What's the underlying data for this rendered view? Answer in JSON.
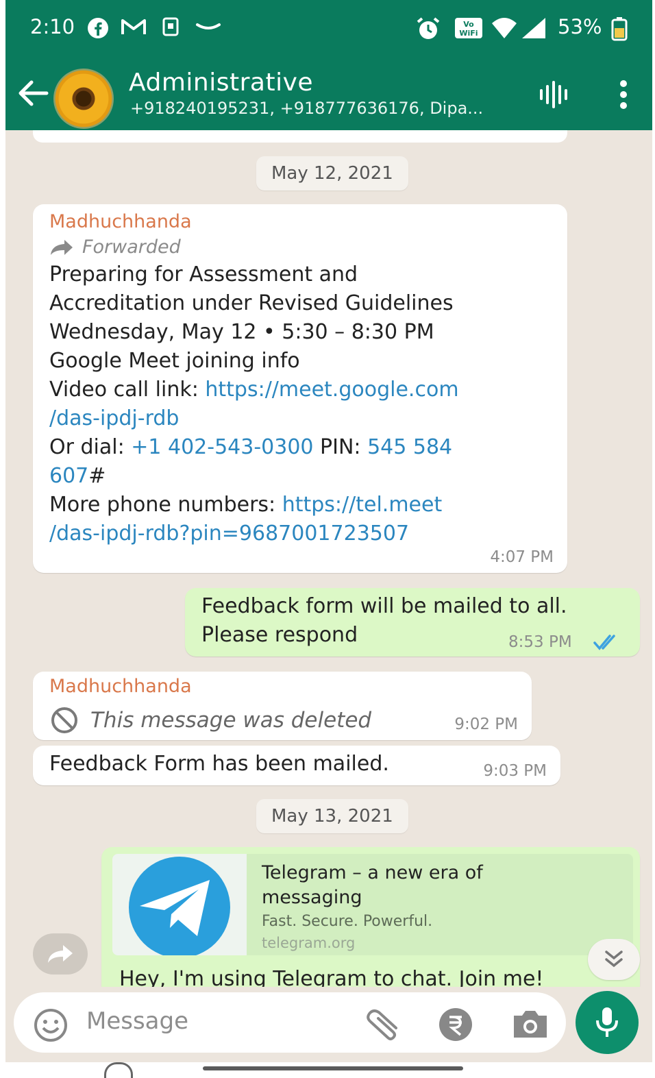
{
  "status_bar": {
    "time": "2:10",
    "battery": "53%"
  },
  "header": {
    "title": "Administrative",
    "subtitle": "+918240195231, +918777636176, Dipa..."
  },
  "chat": {
    "date_1": "May 12, 2021",
    "message_1": {
      "sender": "Madhuchhanda",
      "forwarded": "Forwarded",
      "line1": "Preparing for Assessment and",
      "line2": "Accreditation under Revised Guidelines",
      "line3": "Wednesday, May 12  •  5:30 – 8:30 PM",
      "line4": "Google Meet joining info",
      "line5_text": "Video call link: ",
      "line5_link": "https://meet.google.com",
      "line6_link": "/das-ipdj-rdb",
      "line7_text": "Or dial: ",
      "line7_link": "+1 402-543-0300",
      "line7_mid": " PIN: ",
      "line7_link2": "545 584",
      "line8_link": "607",
      "line8_text": "#",
      "line9_text": "More phone numbers: ",
      "line9_link": "https://tel.meet",
      "line10_link": "/das-ipdj-rdb?pin=9687001723507",
      "time": "4:07 PM"
    },
    "message_2": {
      "line1": "Feedback form will be mailed to all.",
      "line2": "Please respond",
      "time": "8:53 PM"
    },
    "message_3": {
      "sender": "Madhuchhanda",
      "text": "This message was deleted",
      "time": "9:02 PM"
    },
    "message_4": {
      "text": "Feedback Form has been mailed.",
      "time": "9:03 PM"
    },
    "date_2": "May 13, 2021",
    "message_5": {
      "preview_title": "Telegram – a new era of messaging",
      "preview_desc": "Fast. Secure. Powerful.",
      "preview_domain": "telegram.org",
      "text": "Hey, I'm using Telegram to chat. Join me!"
    }
  },
  "composer": {
    "placeholder": "Message"
  },
  "colors": {
    "header": "#0a7b5d",
    "outgoing_bubble": "#dcf8c6",
    "incoming_bubble": "#ffffff",
    "chat_bg": "#ece5dd",
    "link": "#2b86bf",
    "sender": "#d9784b",
    "mic_button": "#0d8f6c"
  },
  "icons": [
    "facebook-icon",
    "gmail-icon",
    "notification-icon",
    "amazon-icon",
    "alarm-icon",
    "vowifi-icon",
    "wifi-icon",
    "signal-icon",
    "battery-icon",
    "back-arrow-icon",
    "voice-chat-icon",
    "more-vert-icon",
    "forward-icon",
    "deleted-icon",
    "double-check-icon",
    "telegram-logo-icon",
    "share-forward-icon",
    "scroll-down-icon",
    "emoji-icon",
    "attach-icon",
    "rupee-icon",
    "camera-icon",
    "mic-icon"
  ]
}
